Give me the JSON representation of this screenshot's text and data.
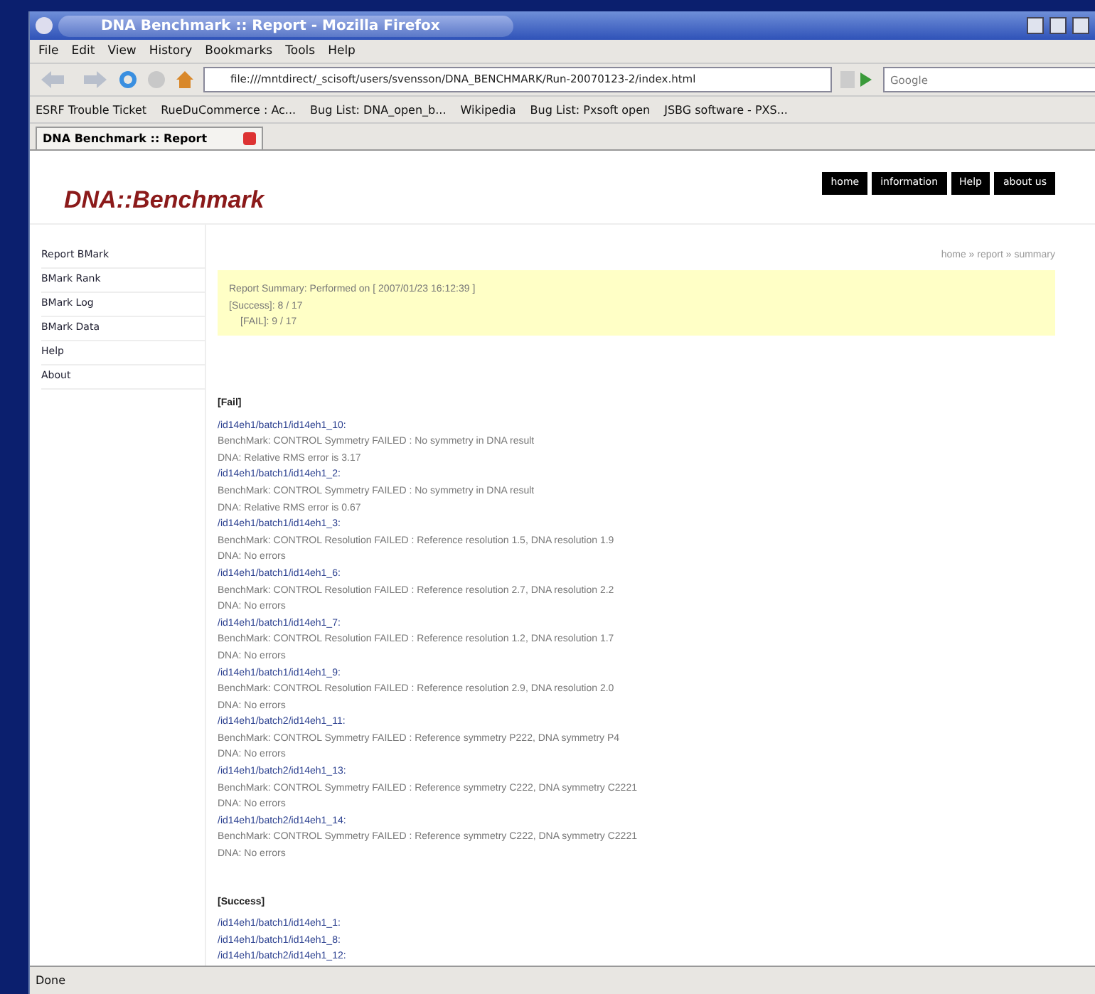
{
  "window": {
    "title": "DNA Benchmark :: Report - Mozilla Firefox"
  },
  "menu": [
    "File",
    "Edit",
    "View",
    "History",
    "Bookmarks",
    "Tools",
    "Help"
  ],
  "address": {
    "value": "file:///mntdirect/_scisoft/users/svensson/DNA_BENCHMARK/Run-20070123-2/index.html"
  },
  "search": {
    "placeholder": "Google"
  },
  "bookmarks": [
    "ESRF Trouble Ticket",
    "RueDuCommerce : Ac...",
    "Bug List: DNA_open_b...",
    "Wikipedia",
    "Bug List: Pxsoft open",
    "JSBG software - PXS..."
  ],
  "tabs": [
    {
      "label": "DNA Benchmark :: Report",
      "selected": true
    }
  ],
  "page": {
    "logo": "DNA::Benchmark",
    "nav": [
      "home",
      "information",
      "Help",
      "about us"
    ],
    "sidebar": [
      "Report BMark",
      "BMark Rank",
      "BMark Log",
      "BMark Data",
      "Help",
      "About"
    ],
    "breadcrumb": "home » report » summary",
    "summary": [
      "Report Summary: Performed on [ 2007/01/23 16:12:39 ]",
      "[Success]: 8 / 17",
      "[FAIL]: 9 / 17"
    ],
    "fail_heading": "[Fail]",
    "failures": [
      {
        "path": "/id14eh1/batch1/id14eh1_10:",
        "message": "BenchMark: CONTROL Symmetry FAILED : No symmetry in DNA result",
        "detail": "DNA: Relative RMS error is 3.17"
      },
      {
        "path": "/id14eh1/batch1/id14eh1_2:",
        "message": "BenchMark: CONTROL Symmetry FAILED : No symmetry in DNA result",
        "detail": "DNA: Relative RMS error is 0.67"
      },
      {
        "path": "/id14eh1/batch1/id14eh1_3:",
        "message": "BenchMark: CONTROL Resolution FAILED : Reference resolution 1.5, DNA resolution 1.9",
        "detail": "DNA: No errors"
      },
      {
        "path": "/id14eh1/batch1/id14eh1_6:",
        "message": "BenchMark: CONTROL Resolution FAILED : Reference resolution 2.7, DNA resolution 2.2",
        "detail": "DNA: No errors"
      },
      {
        "path": "/id14eh1/batch1/id14eh1_7:",
        "message": "BenchMark: CONTROL Resolution FAILED : Reference resolution 1.2, DNA resolution 1.7",
        "detail": "DNA: No errors"
      },
      {
        "path": "/id14eh1/batch1/id14eh1_9:",
        "message": "BenchMark: CONTROL Resolution FAILED : Reference resolution 2.9, DNA resolution 2.0",
        "detail": "DNA: No errors"
      },
      {
        "path": "/id14eh1/batch2/id14eh1_11:",
        "message": "BenchMark: CONTROL Symmetry FAILED : Reference symmetry P222, DNA symmetry P4",
        "detail": "DNA: No errors"
      },
      {
        "path": "/id14eh1/batch2/id14eh1_13:",
        "message": "BenchMark: CONTROL Symmetry FAILED : Reference symmetry C222, DNA symmetry C2221",
        "detail": "DNA: No errors"
      },
      {
        "path": "/id14eh1/batch2/id14eh1_14:",
        "message": "BenchMark: CONTROL Symmetry FAILED : Reference symmetry C222, DNA symmetry C2221",
        "detail": "DNA: No errors"
      }
    ],
    "success_heading": "[Success]",
    "successes": [
      "/id14eh1/batch1/id14eh1_1:",
      "/id14eh1/batch1/id14eh1_8:",
      "/id14eh1/batch2/id14eh1_12:"
    ]
  },
  "status_bar": "Done"
}
